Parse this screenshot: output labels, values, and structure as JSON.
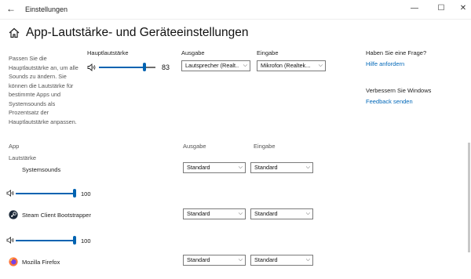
{
  "window": {
    "title": "Einstellungen",
    "back_glyph": "←",
    "minimize_glyph": "—",
    "maximize_glyph": "☐",
    "close_glyph": "✕"
  },
  "page": {
    "title": "App-Lautstärke- und Geräteeinstellungen",
    "description": "Passen Sie die Hauptlautstärke an, um alle Sounds zu ändern. Sie können die Lautstärke für bestimmte Apps und Systemsounds als Prozentsatz der Hauptlautstärke anpassen."
  },
  "master": {
    "label": "Hauptlautstärke",
    "value": "83",
    "level": 0.83,
    "icon": "speaker-icon"
  },
  "output_device": {
    "label": "Ausgabe",
    "value": "Lautsprecher (Realt..."
  },
  "input_device": {
    "label": "Eingabe",
    "value": "Mikrofon (Realtek..."
  },
  "help": {
    "question": "Haben Sie eine Frage?",
    "link": "Hilfe anfordern",
    "improve": "Verbessern Sie Windows",
    "feedback": "Feedback senden"
  },
  "columns": {
    "app": "App",
    "volume": "Lautstärke",
    "output": "Ausgabe",
    "input": "Eingabe"
  },
  "apps": [
    {
      "name": "Systemsounds",
      "volume": "100",
      "level": 1.0,
      "output": "Standard",
      "input": "Standard",
      "icon": "system-sounds-icon"
    },
    {
      "name": "Steam Client Bootstrapper",
      "volume": "100",
      "level": 1.0,
      "output": "Standard",
      "input": "Standard",
      "icon": "steam-icon"
    },
    {
      "name": "Mozilla Firefox",
      "volume": "",
      "output": "Standard",
      "input": "Standard",
      "icon": "firefox-icon"
    }
  ],
  "colors": {
    "accent": "#0063b1",
    "link": "#0067b8"
  }
}
